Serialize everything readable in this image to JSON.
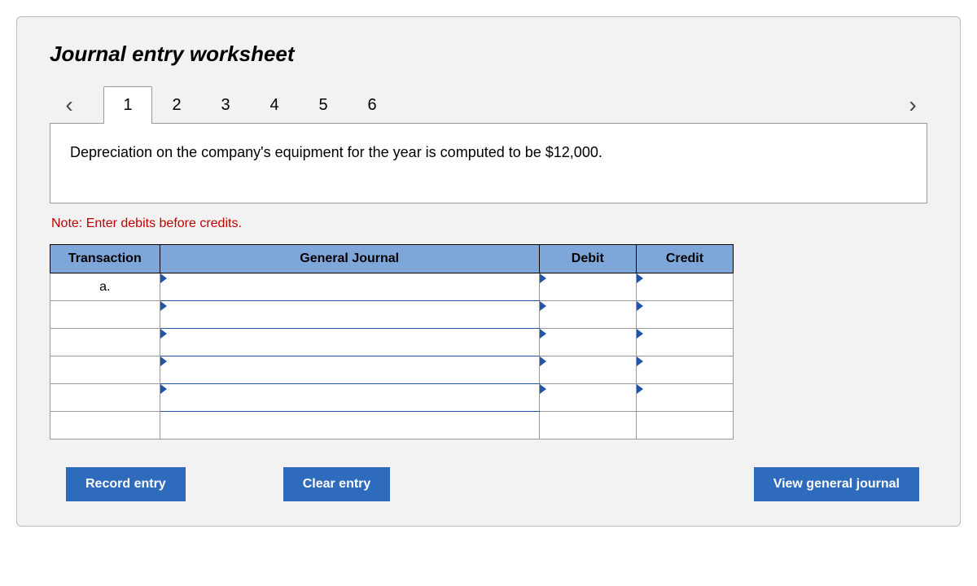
{
  "title": "Journal entry worksheet",
  "nav": {
    "tabs": [
      "1",
      "2",
      "3",
      "4",
      "5",
      "6"
    ],
    "active_index": 0
  },
  "description": "Depreciation on the company's equipment for the year is computed to be $12,000.",
  "note": "Note: Enter debits before credits.",
  "table": {
    "headers": {
      "transaction": "Transaction",
      "general_journal": "General Journal",
      "debit": "Debit",
      "credit": "Credit"
    },
    "rows": [
      {
        "transaction": "a.",
        "general_journal": "",
        "debit": "",
        "credit": ""
      },
      {
        "transaction": "",
        "general_journal": "",
        "debit": "",
        "credit": ""
      },
      {
        "transaction": "",
        "general_journal": "",
        "debit": "",
        "credit": ""
      },
      {
        "transaction": "",
        "general_journal": "",
        "debit": "",
        "credit": ""
      },
      {
        "transaction": "",
        "general_journal": "",
        "debit": "",
        "credit": ""
      },
      {
        "transaction": "",
        "general_journal": "",
        "debit": "",
        "credit": ""
      }
    ]
  },
  "buttons": {
    "record": "Record entry",
    "clear": "Clear entry",
    "view": "View general journal"
  }
}
